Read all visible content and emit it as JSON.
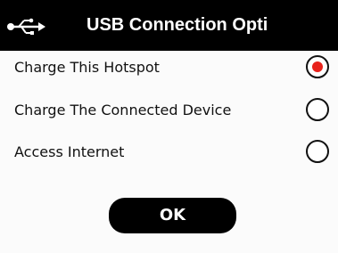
{
  "header": {
    "icon": "usb-icon",
    "title": "USB Connection Opti"
  },
  "options": [
    {
      "label": "Charge This Hotspot",
      "selected": true
    },
    {
      "label": "Charge The Connected Device",
      "selected": false
    },
    {
      "label": "Access Internet",
      "selected": false
    }
  ],
  "ok_button": {
    "label": "OK"
  },
  "colors": {
    "header_bg": "#000000",
    "header_text": "#ffffff",
    "radio_selected": "#e8221b",
    "button_bg": "#000000",
    "button_text": "#ffffff"
  }
}
